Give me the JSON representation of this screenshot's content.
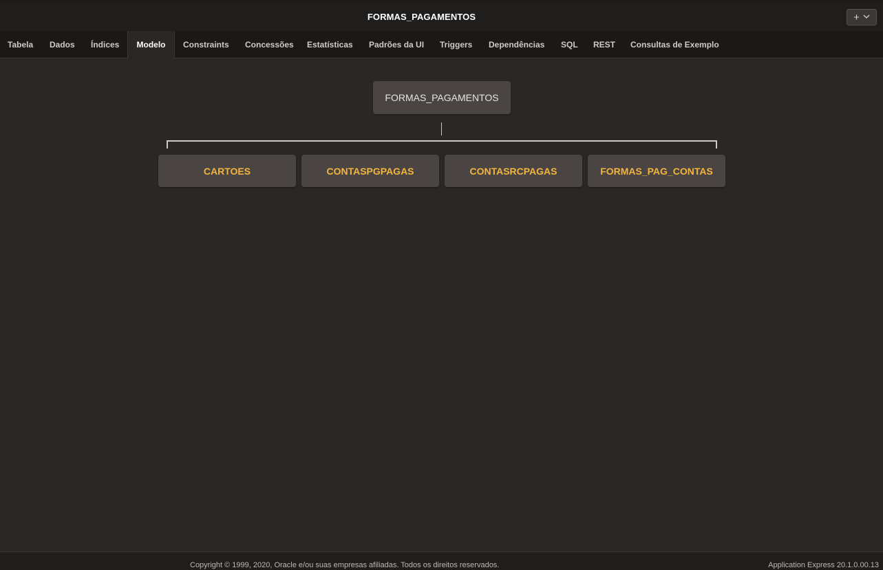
{
  "window": {
    "title": "FORMAS_PAGAMENTOS",
    "add_menu": {
      "plus_icon": "+",
      "chevron_icon": "chevron-down"
    }
  },
  "tabs": [
    {
      "label": "Tabela"
    },
    {
      "label": "Dados"
    },
    {
      "label": "Índices"
    },
    {
      "label": "Modelo",
      "active": true
    },
    {
      "label": "Constraints"
    },
    {
      "label": "Concessões"
    },
    {
      "label": "Estatísticas"
    },
    {
      "label": "Padrões da UI"
    },
    {
      "label": "Triggers"
    },
    {
      "label": "Dependências"
    },
    {
      "label": "SQL"
    },
    {
      "label": "REST"
    },
    {
      "label": "Consultas de Exemplo"
    }
  ],
  "model": {
    "root": "FORMAS_PAGAMENTOS",
    "children": [
      "CARTOES",
      "CONTASPGPAGAS",
      "CONTASRCPAGAS",
      "FORMAS_PAG_CONTAS"
    ],
    "child_color": "#f3b43f"
  },
  "footer": {
    "copyright": "Copyright © 1999, 2020, Oracle e/ou suas empresas afiliadas. Todos os direitos reservados.",
    "version": "Application Express 20.1.0.00.13"
  }
}
